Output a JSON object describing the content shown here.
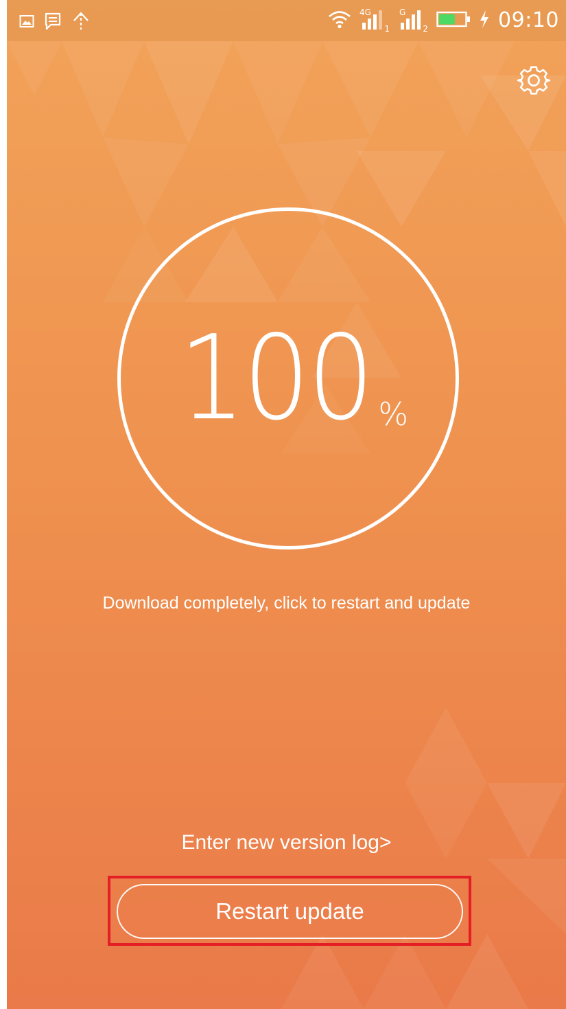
{
  "status_bar": {
    "time": "09:10",
    "signal_1_label": "4G",
    "signal_1_index": "1",
    "signal_2_label": "G",
    "signal_2_index": "2",
    "battery_fill": 0.6,
    "notification_icons": [
      "image-icon",
      "message-icon",
      "upload-icon"
    ],
    "right_icons": [
      "wifi-icon",
      "signal-icon",
      "signal-icon",
      "battery-icon",
      "charging-icon"
    ]
  },
  "header": {
    "settings_icon": "gear-icon"
  },
  "progress": {
    "value": "100",
    "unit": "%",
    "fraction": 1.0
  },
  "main": {
    "status_text": "Download completely, click to restart and update",
    "version_log_link": "Enter new version log>",
    "restart_button": "Restart update"
  },
  "colors": {
    "background_top": "#f2a35a",
    "background_bottom": "#ea7a49",
    "text": "#ffffff",
    "highlight_box": "#e41e25",
    "battery_green": "#4cd964"
  }
}
